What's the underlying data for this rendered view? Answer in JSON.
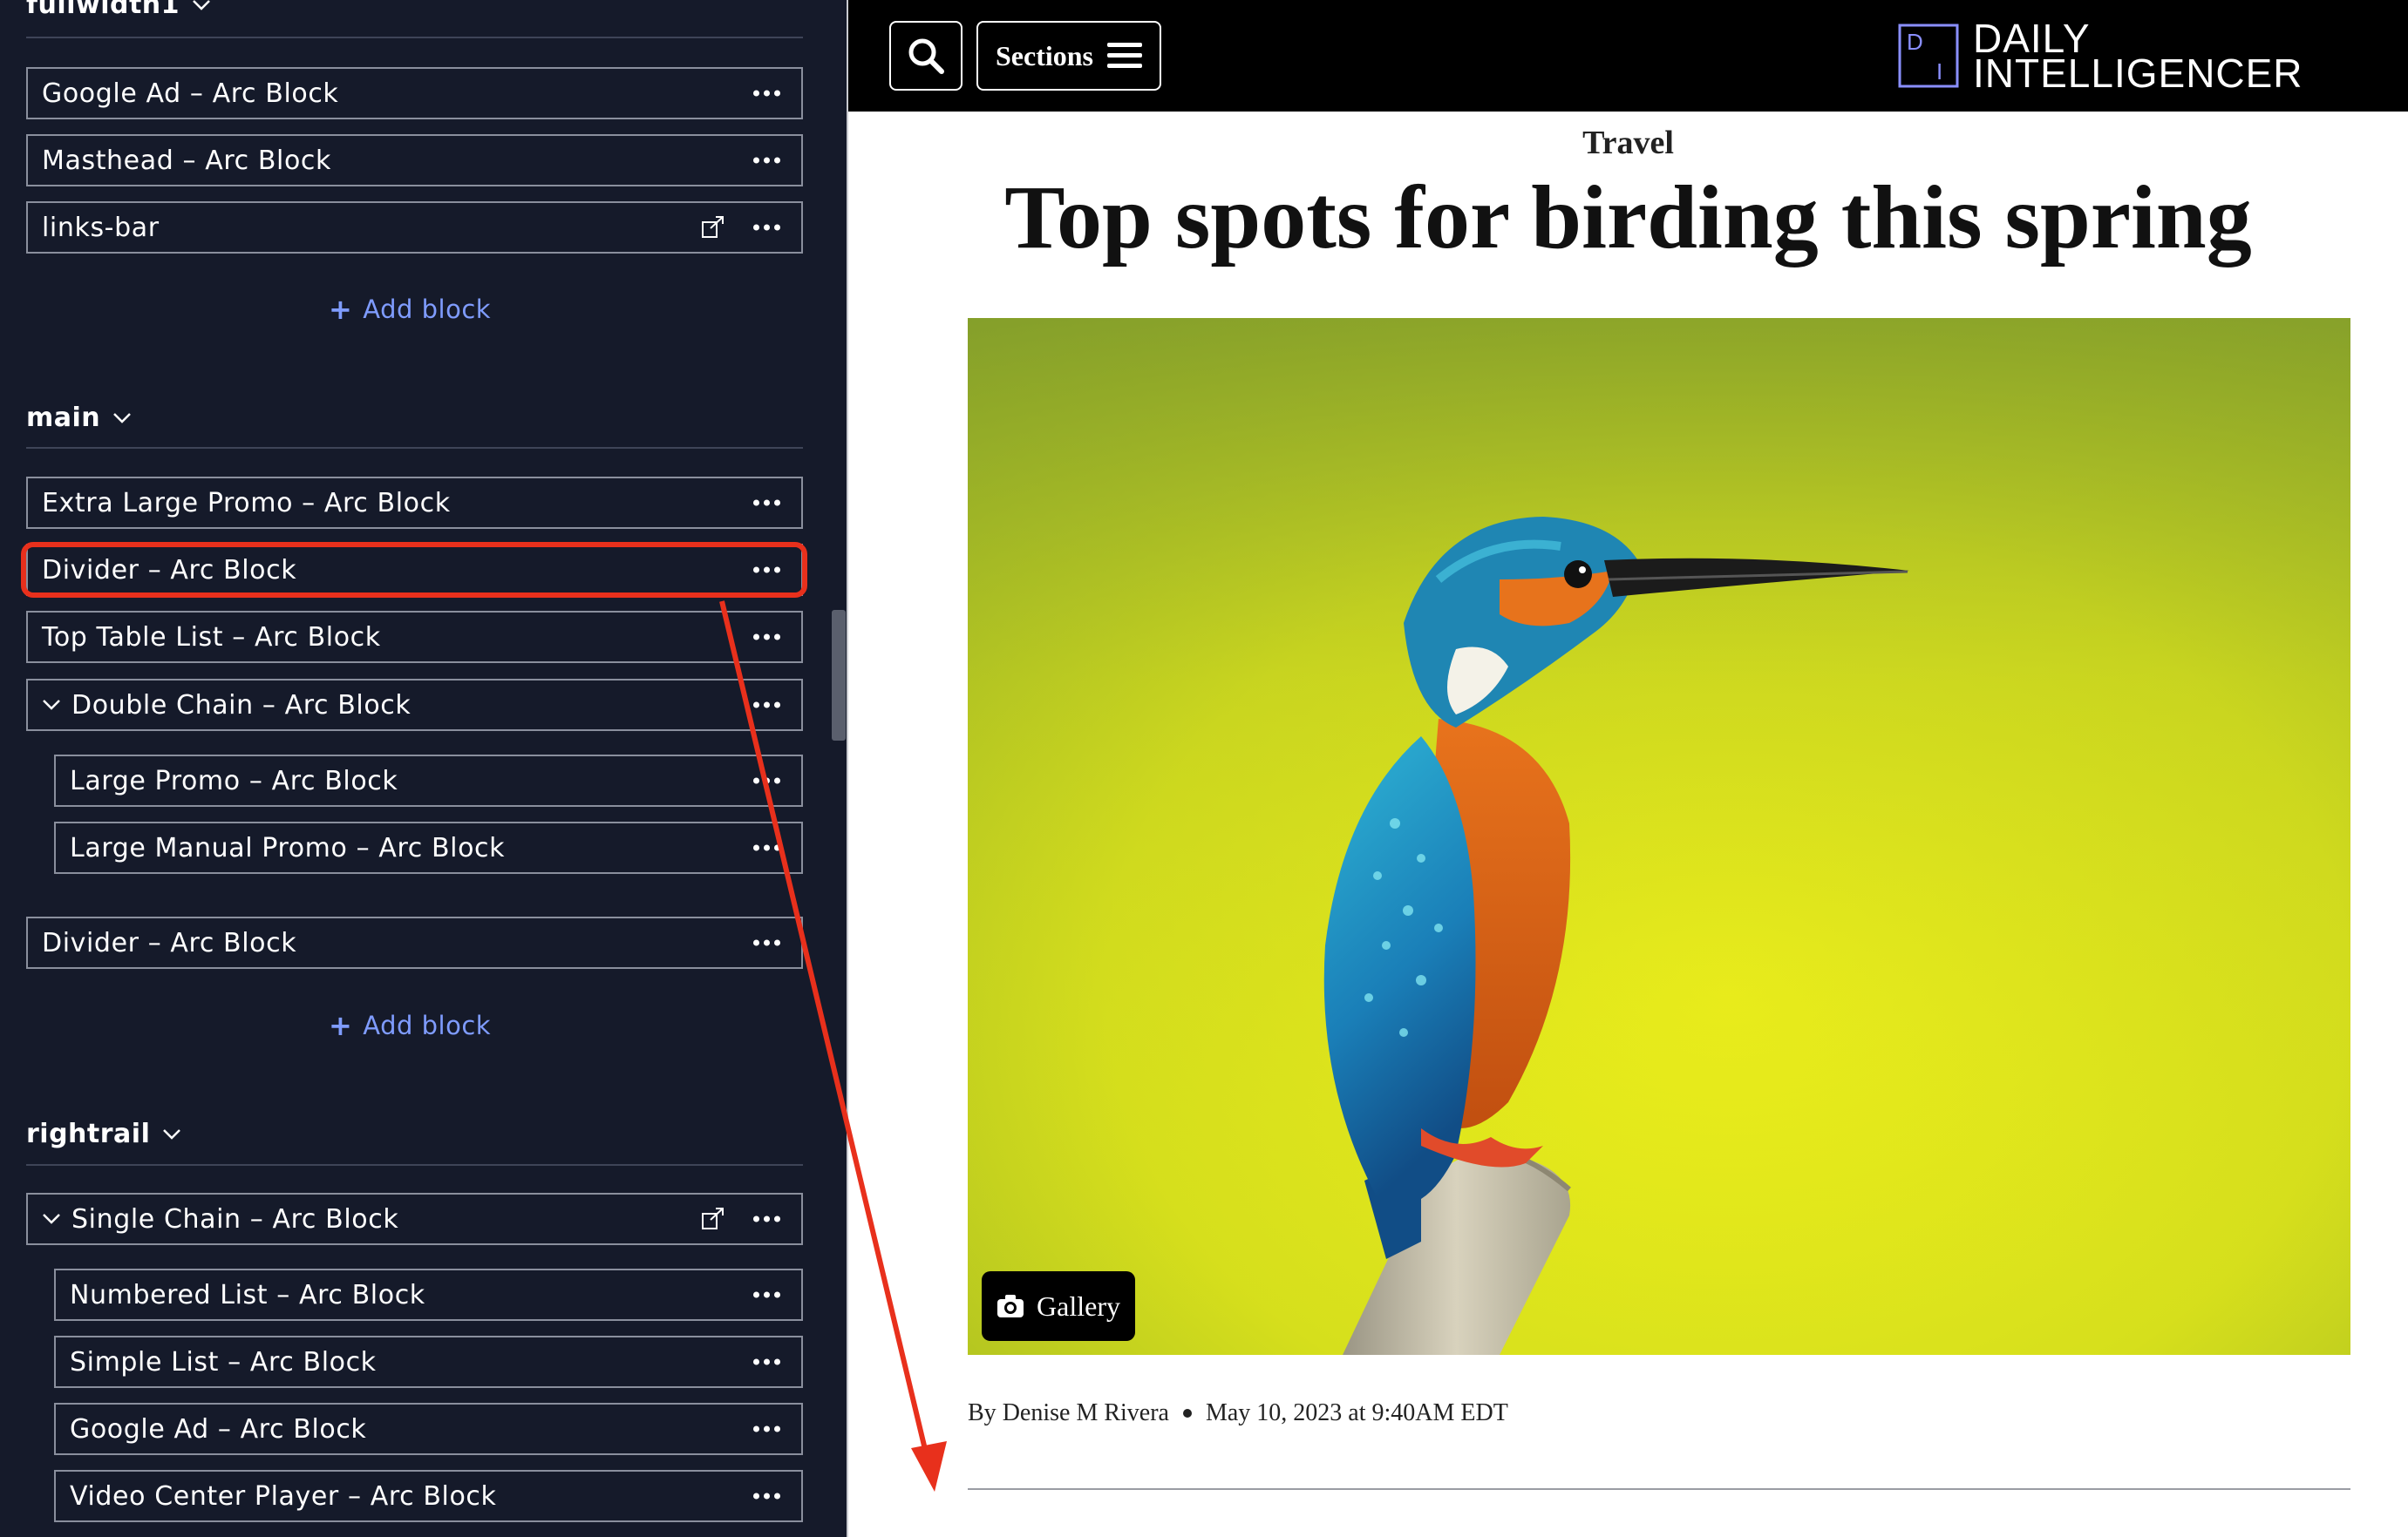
{
  "editor": {
    "sections": [
      {
        "name": "fullwidth1",
        "blocks": [
          {
            "label": "Google Ad – Arc Block"
          },
          {
            "label": "Masthead – Arc Block"
          },
          {
            "label": "links-bar"
          }
        ],
        "add_label": "Add block"
      },
      {
        "name": "main",
        "blocks": [
          {
            "label": "Extra Large Promo – Arc Block"
          },
          {
            "label": "Divider – Arc Block"
          },
          {
            "label": "Top Table List – Arc Block"
          },
          {
            "label": "Double Chain – Arc Block"
          },
          {
            "label": "Large Promo – Arc Block"
          },
          {
            "label": "Large Manual Promo – Arc Block"
          },
          {
            "label": "Divider – Arc Block"
          }
        ],
        "add_label": "Add block"
      },
      {
        "name": "rightrail",
        "blocks": [
          {
            "label": "Single Chain – Arc Block"
          },
          {
            "label": "Numbered List – Arc Block"
          },
          {
            "label": "Simple List – Arc Block"
          },
          {
            "label": "Google Ad – Arc Block"
          },
          {
            "label": "Video Center Player – Arc Block"
          }
        ]
      }
    ]
  },
  "preview": {
    "topbar": {
      "sections_label": "Sections",
      "logo_line1": "DAILY",
      "logo_line2": "INTELLIGENCER",
      "logo_mark_letters": [
        "D",
        "I"
      ]
    },
    "article": {
      "kicker": "Travel",
      "headline": "Top spots for birding this spring",
      "gallery_label": "Gallery",
      "byline_prefix": "By",
      "author": "Denise M Rivera",
      "date": "May 10, 2023 at 9:40AM EDT"
    }
  },
  "colors": {
    "panel_bg": "#151a2a",
    "add_block_link": "#7f9cff",
    "annotation_red": "#e8301c",
    "photo_bg_yellow": "#e2e51c"
  }
}
